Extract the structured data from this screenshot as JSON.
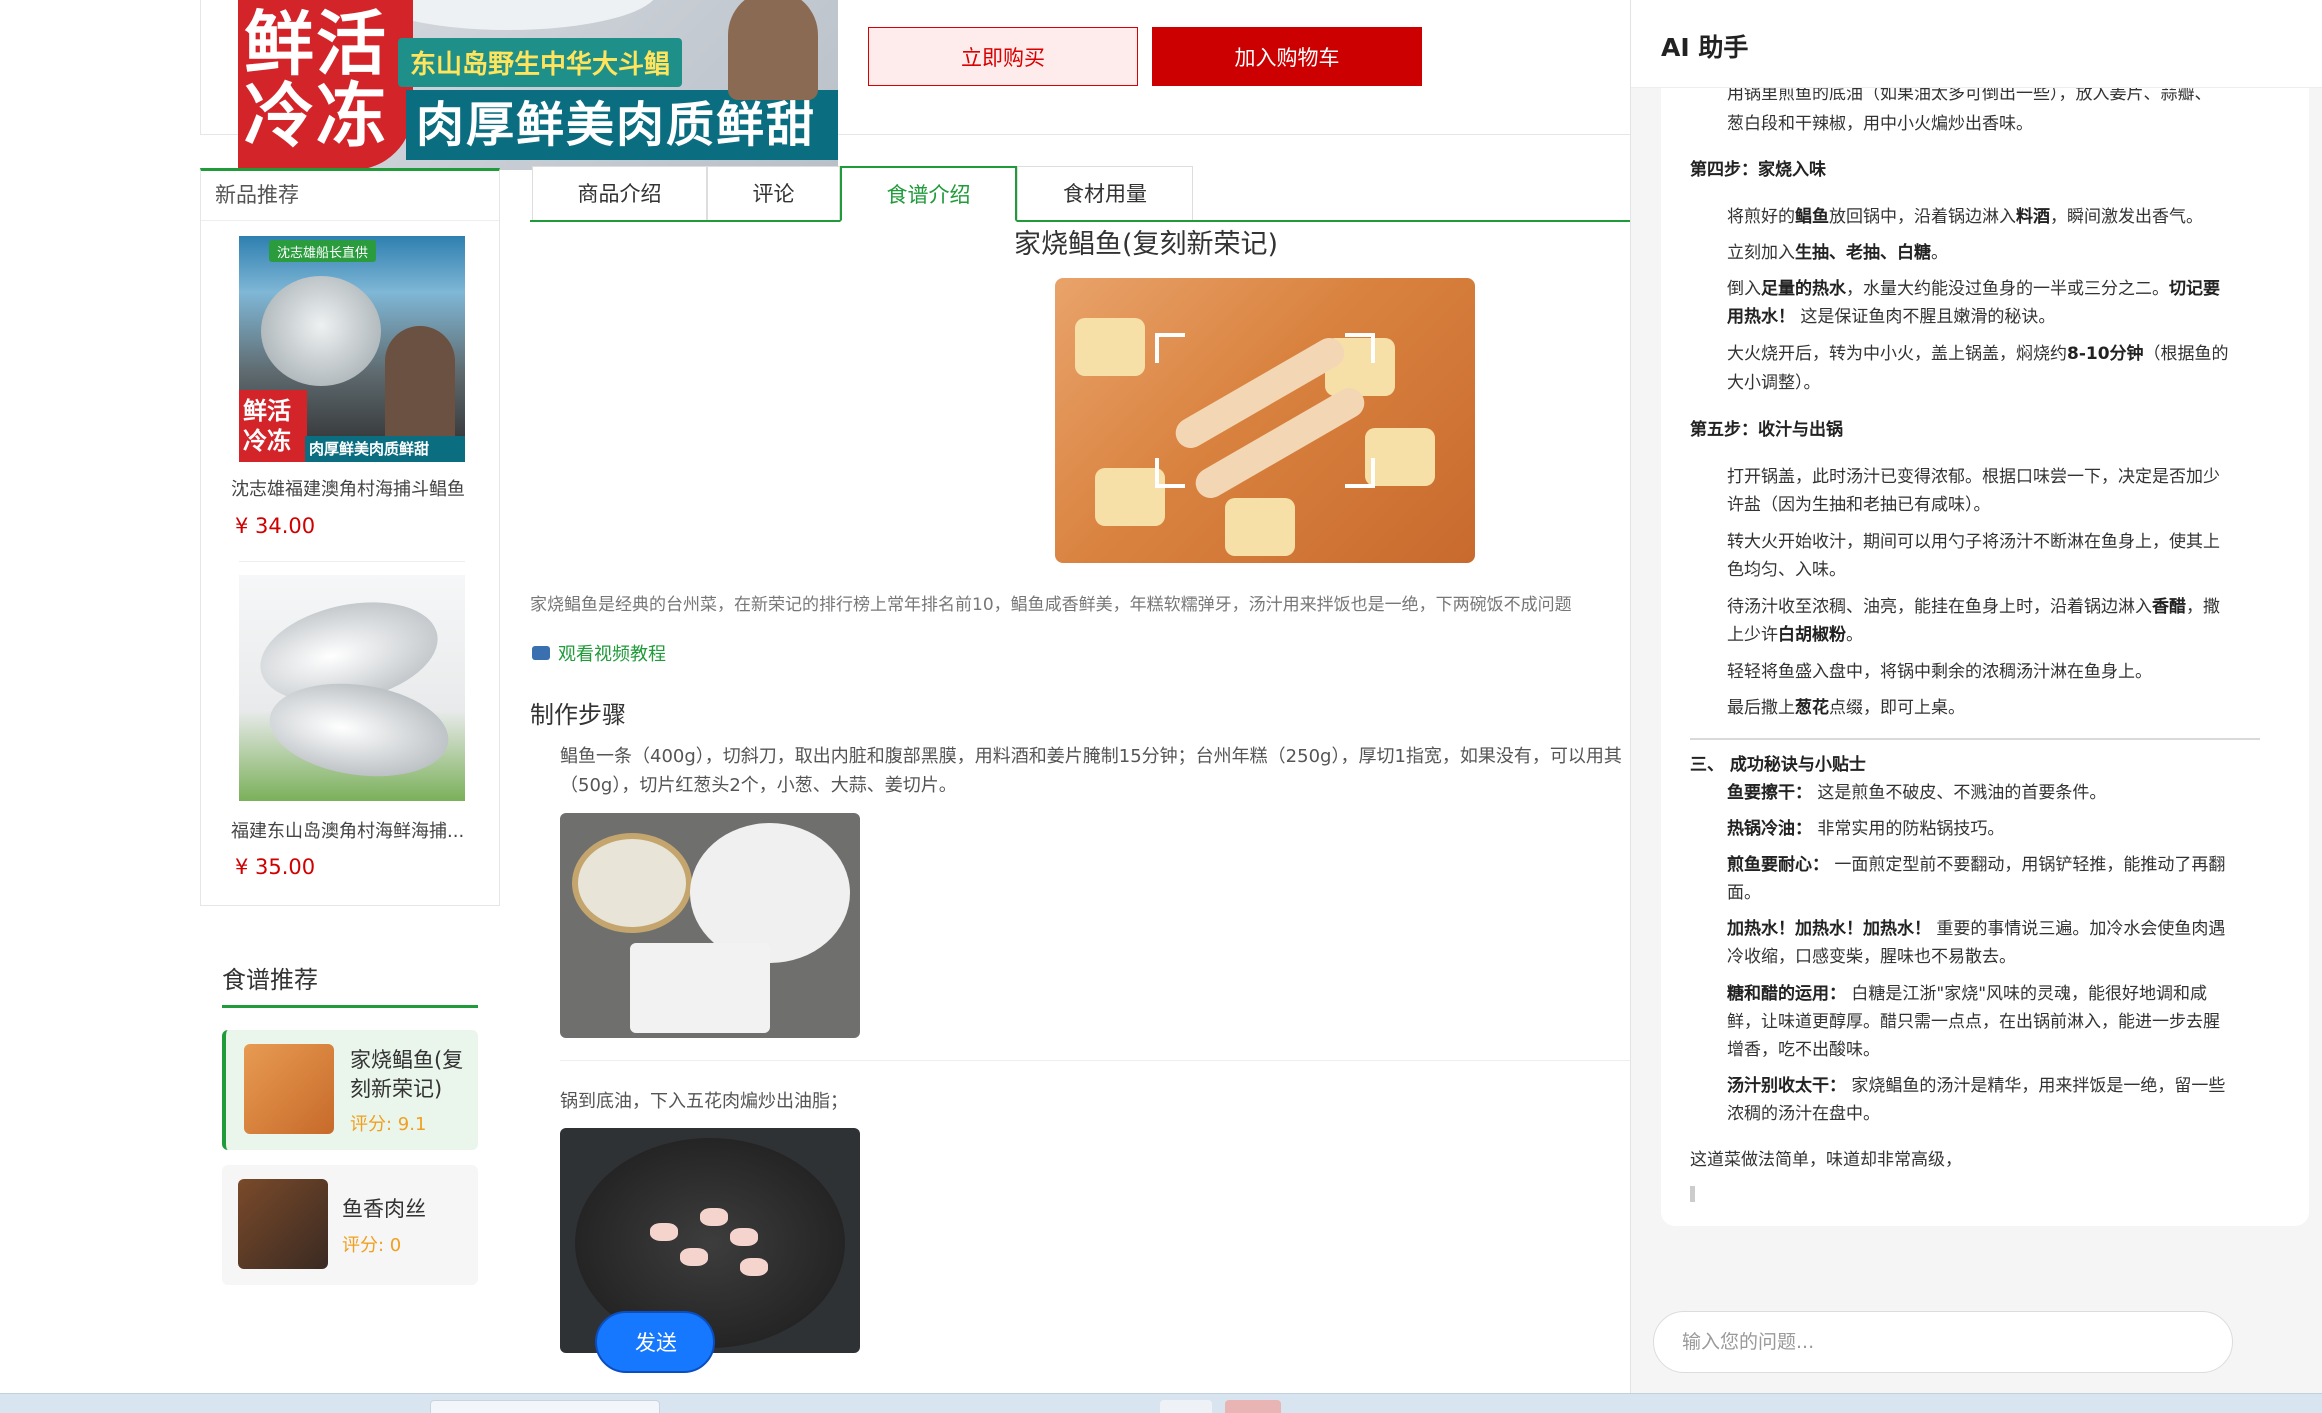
{
  "product": {
    "hero": {
      "big_text": "鲜活\n冷冻",
      "tag_text": "东山岛野生中华大斗鲳",
      "strip_text": "肉厚鲜美肉质鲜甜"
    },
    "buy_now_label": "立即购买",
    "add_cart_label": "加入购物车"
  },
  "new_products": {
    "title": "新品推荐",
    "items": [
      {
        "name": "沈志雄福建澳角村海捕斗鲳鱼",
        "price": "¥ 34.00",
        "badge": "沈志雄船长直供",
        "img_big": "鲜活\n冷冻",
        "img_strip": "肉厚鲜美肉质鲜甜"
      },
      {
        "name": "福建东山岛澳角村海鲜海捕...",
        "price": "¥ 35.00"
      }
    ]
  },
  "tabs": [
    {
      "label": "商品介绍",
      "active": false
    },
    {
      "label": "评论",
      "active": false
    },
    {
      "label": "食谱介绍",
      "active": true
    },
    {
      "label": "食材用量",
      "active": false
    }
  ],
  "recipe": {
    "title": "家烧鲳鱼(复刻新荣记)",
    "intro": "家烧鲳鱼是经典的台州菜，在新荣记的排行榜上常年排名前10，鲳鱼咸香鲜美，年糕软糯弹牙，汤汁用来拌饭也是一绝，下两碗饭不成问题",
    "video_link": "观看视频教程",
    "steps_heading": "制作步骤",
    "steps": [
      {
        "text_line1": "鲳鱼一条（400g），切斜刀，取出内脏和腹部黑膜，用料酒和姜片腌制15分钟；台州年糕（250g），厚切1指宽，如果没有，可以用其",
        "text_line2": "（50g），切片红葱头2个，小葱、大蒜、姜切片。"
      },
      {
        "text_line1": "锅到底油，下入五花肉煸炒出油脂；"
      }
    ]
  },
  "recipe_recommend": {
    "title": "食谱推荐",
    "items": [
      {
        "name": "家烧鲳鱼(复刻新荣记)",
        "score": "评分: 9.1",
        "active": true
      },
      {
        "name": "鱼香肉丝",
        "score": "评分: 0",
        "active": false
      }
    ]
  },
  "ai": {
    "title": "AI 助手",
    "lines": {
      "l0": "用锅里煎鱼的底油（如果油太多可倒出一些），放入姜片、蒜瓣、",
      "l1": "葱白段和干辣椒，用中小火煸炒出香味。",
      "s4": "第四步：家烧入味",
      "s4a_pre": "将煎好的",
      "s4a_b1": "鲳鱼",
      "s4a_mid": "放回锅中，沿着锅边淋入",
      "s4a_b2": "料酒",
      "s4a_post": "，瞬间激发出香气。",
      "s4b_pre": "立刻加入",
      "s4b_b": "生抽、老抽、白糖",
      "s4b_post": "。",
      "s4c_pre": "倒入",
      "s4c_b1": "足量的热水",
      "s4c_mid": "，水量大约能没过鱼身的一半或三分之二。",
      "s4c_b2": "切记要",
      "s4c2_b": "用热水！",
      "s4c2_post": " 这是保证鱼肉不腥且嫩滑的秘诀。",
      "s4d_pre": "大火烧开后，转为中小火，盖上锅盖，焖烧约",
      "s4d_b": "8-10分钟",
      "s4d_post": "（根据鱼的",
      "s4d2": "大小调整）。",
      "s5": "第五步：收汁与出锅",
      "s5a": "打开锅盖，此时汤汁已变得浓郁。根据口味尝一下，决定是否加少",
      "s5a2": "许盐（因为生抽和老抽已有咸味）。",
      "s5b": "转大火开始收汁，期间可以用勺子将汤汁不断淋在鱼身上，使其上",
      "s5b2": "色均匀、入味。",
      "s5c_pre": "待汤汁收至浓稠、油亮，能挂在鱼身上时，沿着锅边淋入",
      "s5c_b": "香醋",
      "s5c_post": "，撒",
      "s5c2_pre": "上少许",
      "s5c2_b": "白胡椒粉",
      "s5c2_post": "。",
      "s5d": "轻轻将鱼盛入盘中，将锅中剩余的浓稠汤汁淋在鱼身上。",
      "s5e_pre": "最后撒上",
      "s5e_b": "葱花",
      "s5e_post": "点缀，即可上桌。",
      "t3": "三、 成功秘诀与小贴士",
      "t1_b": "鱼要擦干：",
      "t1": " 这是煎鱼不破皮、不溅油的首要条件。",
      "t2_b": "热锅冷油：",
      "t2": " 非常实用的防粘锅技巧。",
      "t3_b": "煎鱼要耐心：",
      "t3a": " 一面煎定型前不要翻动，用锅铲轻推，能推动了再翻",
      "t3a2": "面。",
      "t4_b": "加热水！加热水！加热水！",
      "t4": " 重要的事情说三遍。加冷水会使鱼肉遇",
      "t42": "冷收缩，口感变柴，腥味也不易散去。",
      "t5_b": "糖和醋的运用：",
      "t5": " 白糖是江浙\"家烧\"风味的灵魂，能很好地调和咸",
      "t52": "鲜，让味道更醇厚。醋只需一点点，在出锅前淋入，能进一步去腥",
      "t53": "增香，吃不出酸味。",
      "t6_b": "汤汁别收太干：",
      "t6": " 家烧鲳鱼的汤汁是精华，用来拌饭是一绝，留一些",
      "t62": "浓稠的汤汁在盘中。",
      "end": "这道菜做法简单，味道却非常高级，"
    },
    "input_placeholder": "输入您的问题...",
    "send_label": "发送"
  },
  "colors": {
    "brand_red": "#cc0000",
    "brand_green": "#1f9b3a",
    "send_blue": "#1677ff",
    "price_red": "#d10000",
    "score_orange": "#f0a020"
  }
}
